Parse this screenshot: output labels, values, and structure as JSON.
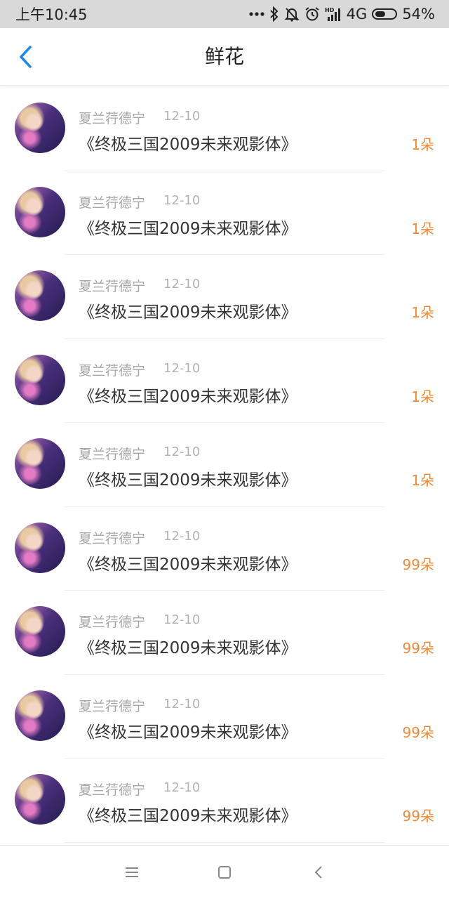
{
  "status_bar": {
    "time": "上午10:45",
    "network": "4G",
    "battery": "54%",
    "battery_level": 0.54
  },
  "header": {
    "title": "鲜花",
    "back_icon": "chevron-left-icon",
    "accent_color": "#1e88e5"
  },
  "list": {
    "items": [
      {
        "name": "夏兰荇德宁",
        "date": "12-10",
        "title": "《终极三国2009未来观影体》",
        "count": "1朵"
      },
      {
        "name": "夏兰荇德宁",
        "date": "12-10",
        "title": "《终极三国2009未来观影体》",
        "count": "1朵"
      },
      {
        "name": "夏兰荇德宁",
        "date": "12-10",
        "title": "《终极三国2009未来观影体》",
        "count": "1朵"
      },
      {
        "name": "夏兰荇德宁",
        "date": "12-10",
        "title": "《终极三国2009未来观影体》",
        "count": "1朵"
      },
      {
        "name": "夏兰荇德宁",
        "date": "12-10",
        "title": "《终极三国2009未来观影体》",
        "count": "1朵"
      },
      {
        "name": "夏兰荇德宁",
        "date": "12-10",
        "title": "《终极三国2009未来观影体》",
        "count": "99朵"
      },
      {
        "name": "夏兰荇德宁",
        "date": "12-10",
        "title": "《终极三国2009未来观影体》",
        "count": "99朵"
      },
      {
        "name": "夏兰荇德宁",
        "date": "12-10",
        "title": "《终极三国2009未来观影体》",
        "count": "99朵"
      },
      {
        "name": "夏兰荇德宁",
        "date": "12-10",
        "title": "《终极三国2009未来观影体》",
        "count": "99朵"
      }
    ],
    "count_color": "#f08a38"
  },
  "nav_bar": {
    "icons": [
      "menu-icon",
      "home-square-icon",
      "back-triangle-icon"
    ]
  }
}
